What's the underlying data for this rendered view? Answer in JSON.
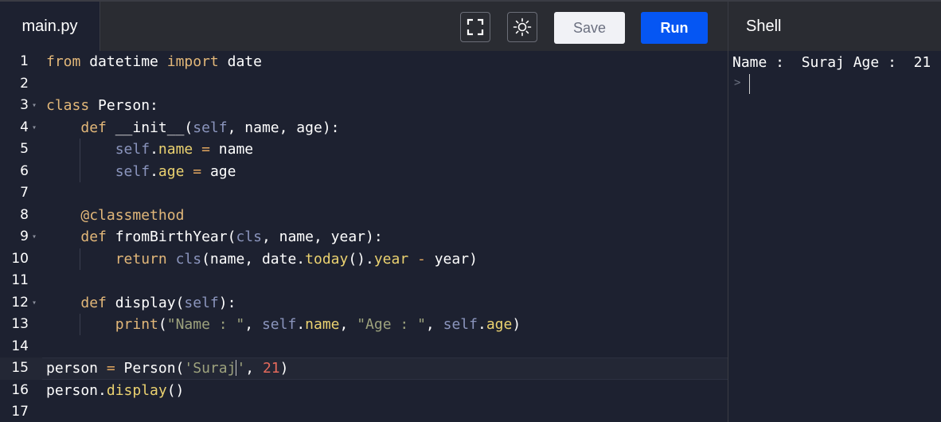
{
  "editor": {
    "file_tab": "main.py",
    "active_line": 15,
    "lines": [
      {
        "n": "1"
      },
      {
        "n": "2"
      },
      {
        "n": "3"
      },
      {
        "n": "4"
      },
      {
        "n": "5"
      },
      {
        "n": "6"
      },
      {
        "n": "7"
      },
      {
        "n": "8"
      },
      {
        "n": "9"
      },
      {
        "n": "10"
      },
      {
        "n": "11"
      },
      {
        "n": "12"
      },
      {
        "n": "13"
      },
      {
        "n": "14"
      },
      {
        "n": "15"
      },
      {
        "n": "16"
      },
      {
        "n": "17"
      }
    ],
    "code": {
      "l1_kw1": "from",
      "l1_mod": " datetime ",
      "l1_kw2": "import",
      "l1_name": " date",
      "l3_kw": "class",
      "l3_rest": " Person:",
      "l4_indent": "    ",
      "l4_kw": "def",
      "l4_a": " __init__(",
      "l4_self": "self",
      "l4_b": ", name, age):",
      "l5_indent": "        ",
      "l5_self": "self",
      "l5_dot": ".",
      "l5_attr": "name",
      "l5_op": " = ",
      "l5_val": "name",
      "l6_indent": "        ",
      "l6_self": "self",
      "l6_dot": ".",
      "l6_attr": "age",
      "l6_op": " = ",
      "l6_val": "age",
      "l8_indent": "    ",
      "l8_deco": "@classmethod",
      "l9_indent": "    ",
      "l9_kw": "def",
      "l9_a": " fromBirthYear(",
      "l9_cls": "cls",
      "l9_b": ", name, year):",
      "l10_indent": "        ",
      "l10_kw": "return",
      "l10_sp": " ",
      "l10_cls": "cls",
      "l10_a": "(name, date.",
      "l10_fn": "today",
      "l10_b": "().",
      "l10_attr": "year",
      "l10_op": " - ",
      "l10_c": "year)",
      "l12_indent": "    ",
      "l12_kw": "def",
      "l12_a": " display(",
      "l12_self": "self",
      "l12_b": "):",
      "l13_indent": "        ",
      "l13_fn": "print",
      "l13_a": "(",
      "l13_s1": "\"Name : \"",
      "l13_b": ", ",
      "l13_self1": "self",
      "l13_c": ".",
      "l13_attr1": "name",
      "l13_d": ", ",
      "l13_s2": "\"Age : \"",
      "l13_e": ", ",
      "l13_self2": "self",
      "l13_f": ".",
      "l13_attr2": "age",
      "l13_g": ")",
      "l15_a": "person ",
      "l15_op": "=",
      "l15_b": " Person(",
      "l15_s1": "'Suraj",
      "l15_s2": "'",
      "l15_c": ", ",
      "l15_num": "21",
      "l15_d": ")",
      "l16_a": "person.",
      "l16_fn": "display",
      "l16_b": "()"
    }
  },
  "toolbar": {
    "fullscreen_icon": "fullscreen-icon",
    "theme_icon": "sun-icon",
    "save_label": "Save",
    "run_label": "Run"
  },
  "shell": {
    "title": "Shell",
    "output": "Name :  Suraj Age :  21",
    "prompt": ">"
  },
  "colors": {
    "background": "#1d2130",
    "topbar": "#2a2c32",
    "run_button": "#0556f3",
    "keyword": "#e2b779",
    "self": "#8b95bd",
    "attribute": "#ebd270",
    "string": "#9da27d",
    "number": "#e56a5c"
  }
}
